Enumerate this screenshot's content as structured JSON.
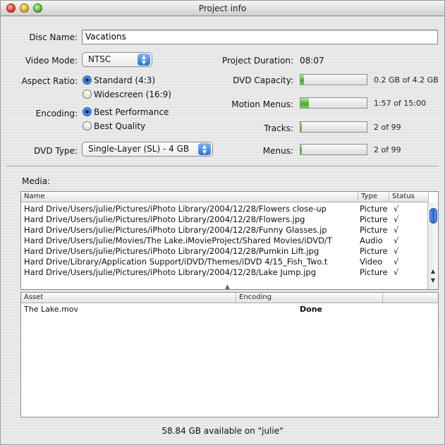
{
  "window": {
    "title": "Project info"
  },
  "form": {
    "disc_name_label": "Disc Name:",
    "disc_name_value": "Vacations",
    "video_mode_label": "Video Mode:",
    "video_mode_value": "NTSC",
    "aspect_ratio_label": "Aspect Ratio:",
    "aspect_standard": "Standard (4:3)",
    "aspect_widescreen": "Widescreen (16:9)",
    "encoding_label": "Encoding:",
    "encoding_best_performance": "Best Performance",
    "encoding_best_quality": "Best Quality",
    "dvd_type_label": "DVD Type:",
    "dvd_type_value": "Single-Layer (SL) - 4 GB"
  },
  "stats": {
    "duration_label": "Project Duration:",
    "duration_value": "08:07",
    "capacity_label": "DVD Capacity:",
    "capacity_value": "0.2 GB of 4.2 GB",
    "capacity_fill": 0.05,
    "motion_label": "Motion Menus:",
    "motion_value": "1:57 of 15:00",
    "motion_fill": 0.13,
    "tracks_label": "Tracks:",
    "tracks_value": "2 of 99",
    "tracks_fill": 0.02,
    "menus_label": "Menus:",
    "menus_value": "2 of 99",
    "menus_fill": 0.02
  },
  "media": {
    "label": "Media:",
    "columns": [
      "Name",
      "Type",
      "Status"
    ],
    "rows": [
      {
        "name": "Hard Drive/Users/julie/Pictures/iPhoto Library/2004/12/28/Flowers close-up",
        "type": "Picture",
        "status": "√"
      },
      {
        "name": "Hard Drive/Users/julie/Pictures/iPhoto Library/2004/12/28/Flowers.jpg",
        "type": "Picture",
        "status": "√"
      },
      {
        "name": "Hard Drive/Users/julie/Pictures/iPhoto Library/2004/12/28/Funny Glasses.jp",
        "type": "Picture",
        "status": "√"
      },
      {
        "name": "Hard Drive/Users/julie/Movies/The Lake.iMovieProject/Shared Movies/iDVD/T",
        "type": "Audio",
        "status": "√"
      },
      {
        "name": "Hard Drive/Users/julie/Pictures/iPhoto Library/2004/12/28/Pumkin Lift.jpg",
        "type": "Picture",
        "status": "√"
      },
      {
        "name": "Hard Drive/Library/Application Support/iDVD/Themes/iDVD 4/15_Fish_Two.t",
        "type": "Video",
        "status": "√"
      },
      {
        "name": "Hard Drive/Users/julie/Pictures/iPhoto Library/2004/12/28/Lake Jump.jpg",
        "type": "Picture",
        "status": "√"
      }
    ]
  },
  "assets": {
    "columns": [
      "Asset",
      "Encoding"
    ],
    "rows": [
      {
        "asset": "The Lake.mov",
        "encoding": "Done"
      }
    ]
  },
  "footer": {
    "available": "58.84 GB available on \"julie\""
  }
}
